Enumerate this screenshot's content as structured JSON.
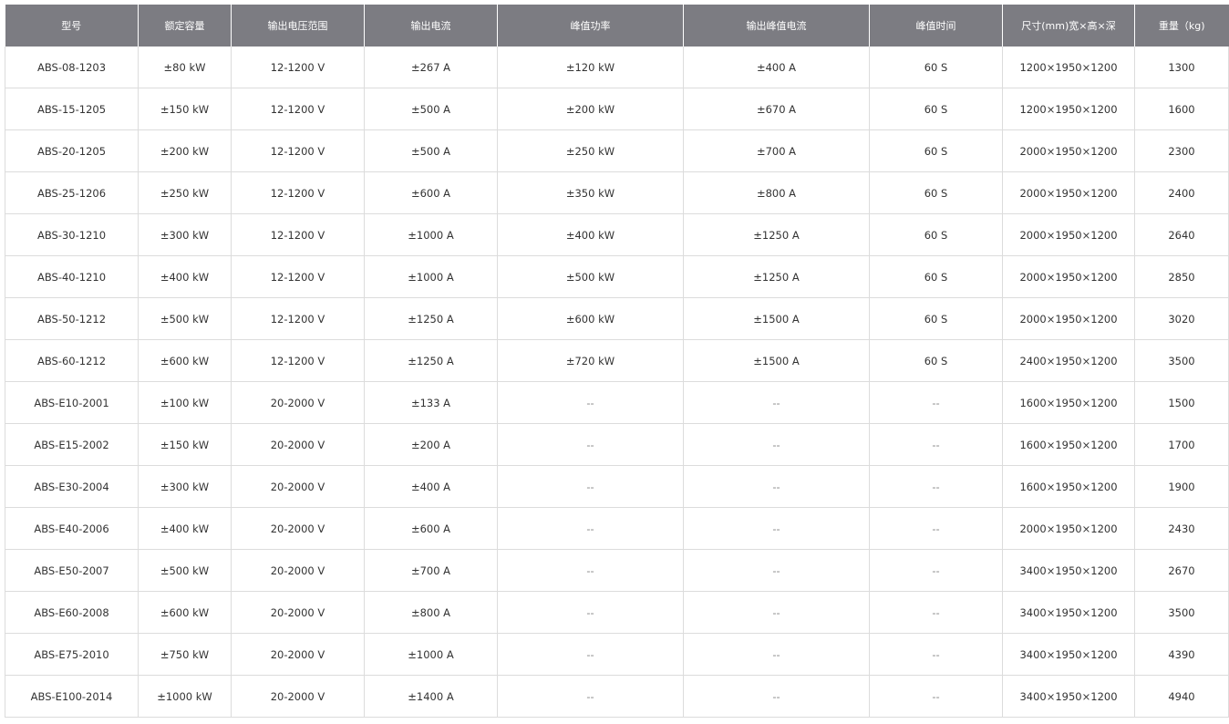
{
  "table": {
    "headers": [
      "型号",
      "额定容量",
      "输出电压范围",
      "输出电流",
      "峰值功率",
      "输出峰值电流",
      "峰值时间",
      "尺寸(mm)宽×高×深",
      "重量（kg)"
    ],
    "rows": [
      [
        "ABS-08-1203",
        "±80 kW",
        "12-1200 V",
        "±267 A",
        "±120 kW",
        "±400 A",
        "60 S",
        "1200×1950×1200",
        "1300"
      ],
      [
        "ABS-15-1205",
        "±150 kW",
        "12-1200 V",
        "±500 A",
        "±200 kW",
        "±670 A",
        "60 S",
        "1200×1950×1200",
        "1600"
      ],
      [
        "ABS-20-1205",
        "±200 kW",
        "12-1200 V",
        "±500 A",
        "±250 kW",
        "±700 A",
        "60 S",
        "2000×1950×1200",
        "2300"
      ],
      [
        "ABS-25-1206",
        "±250 kW",
        "12-1200 V",
        "±600 A",
        "±350 kW",
        "±800 A",
        "60 S",
        "2000×1950×1200",
        "2400"
      ],
      [
        "ABS-30-1210",
        "±300 kW",
        "12-1200 V",
        "±1000 A",
        "±400 kW",
        "±1250 A",
        "60 S",
        "2000×1950×1200",
        "2640"
      ],
      [
        "ABS-40-1210",
        "±400 kW",
        "12-1200 V",
        "±1000 A",
        "±500 kW",
        "±1250 A",
        "60 S",
        "2000×1950×1200",
        "2850"
      ],
      [
        "ABS-50-1212",
        "±500 kW",
        "12-1200 V",
        "±1250 A",
        "±600 kW",
        "±1500 A",
        "60 S",
        "2000×1950×1200",
        "3020"
      ],
      [
        "ABS-60-1212",
        "±600 kW",
        "12-1200 V",
        "±1250 A",
        "±720 kW",
        "±1500 A",
        "60 S",
        "2400×1950×1200",
        "3500"
      ],
      [
        "ABS-E10-2001",
        "±100 kW",
        "20-2000 V",
        "±133 A",
        "--",
        "--",
        "--",
        "1600×1950×1200",
        "1500"
      ],
      [
        "ABS-E15-2002",
        "±150 kW",
        "20-2000 V",
        "±200 A",
        "--",
        "--",
        "--",
        "1600×1950×1200",
        "1700"
      ],
      [
        "ABS-E30-2004",
        "±300 kW",
        "20-2000 V",
        "±400 A",
        "--",
        "--",
        "--",
        "1600×1950×1200",
        "1900"
      ],
      [
        "ABS-E40-2006",
        "±400 kW",
        "20-2000 V",
        "±600 A",
        "--",
        "--",
        "--",
        "2000×1950×1200",
        "2430"
      ],
      [
        "ABS-E50-2007",
        "±500 kW",
        "20-2000 V",
        "±700 A",
        "--",
        "--",
        "--",
        "3400×1950×1200",
        "2670"
      ],
      [
        "ABS-E60-2008",
        "±600 kW",
        "20-2000 V",
        "±800 A",
        "--",
        "--",
        "--",
        "3400×1950×1200",
        "3500"
      ],
      [
        "ABS-E75-2010",
        "±750 kW",
        "20-2000 V",
        "±1000 A",
        "--",
        "--",
        "--",
        "3400×1950×1200",
        "4390"
      ],
      [
        "ABS-E100-2014",
        "±1000 kW",
        "20-2000 V",
        "±1400 A",
        "--",
        "--",
        "--",
        "3400×1950×1200",
        "4940"
      ]
    ]
  },
  "colors": {
    "header_bg": "#7c7c82",
    "header_text": "#ffffff",
    "body_text": "#333333",
    "grid": "#dcdcdc"
  }
}
